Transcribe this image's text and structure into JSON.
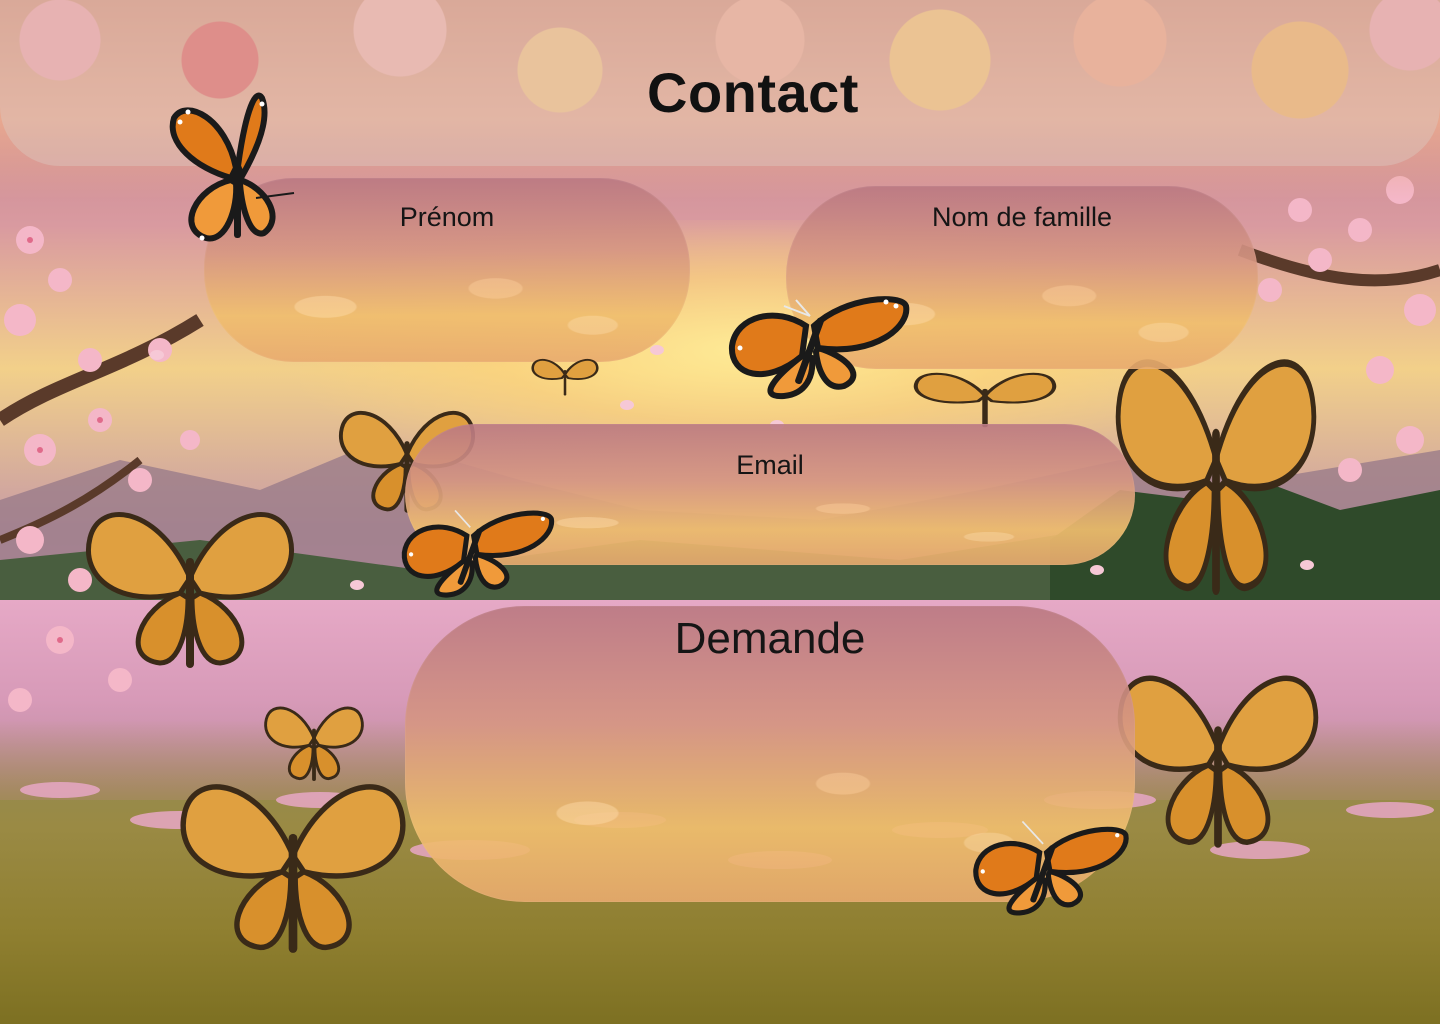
{
  "page": {
    "title": "Contact"
  },
  "form": {
    "first_name": {
      "label": "Prénom",
      "value": ""
    },
    "last_name": {
      "label": "Nom de famille",
      "value": ""
    },
    "email": {
      "label": "Email",
      "value": ""
    },
    "request": {
      "label": "Demande",
      "value": ""
    }
  },
  "colors": {
    "title_text": "#111111",
    "label_text": "#151515",
    "field_top": "#ba7882",
    "field_bottom": "#f0be6e",
    "butterfly_orange": "#e07a1a",
    "butterfly_amber": "#e0a040"
  },
  "decor": {
    "icons": [
      "monarch-butterfly-icon",
      "amber-butterfly-icon",
      "cherry-blossom-branch",
      "meadow-landscape"
    ]
  }
}
